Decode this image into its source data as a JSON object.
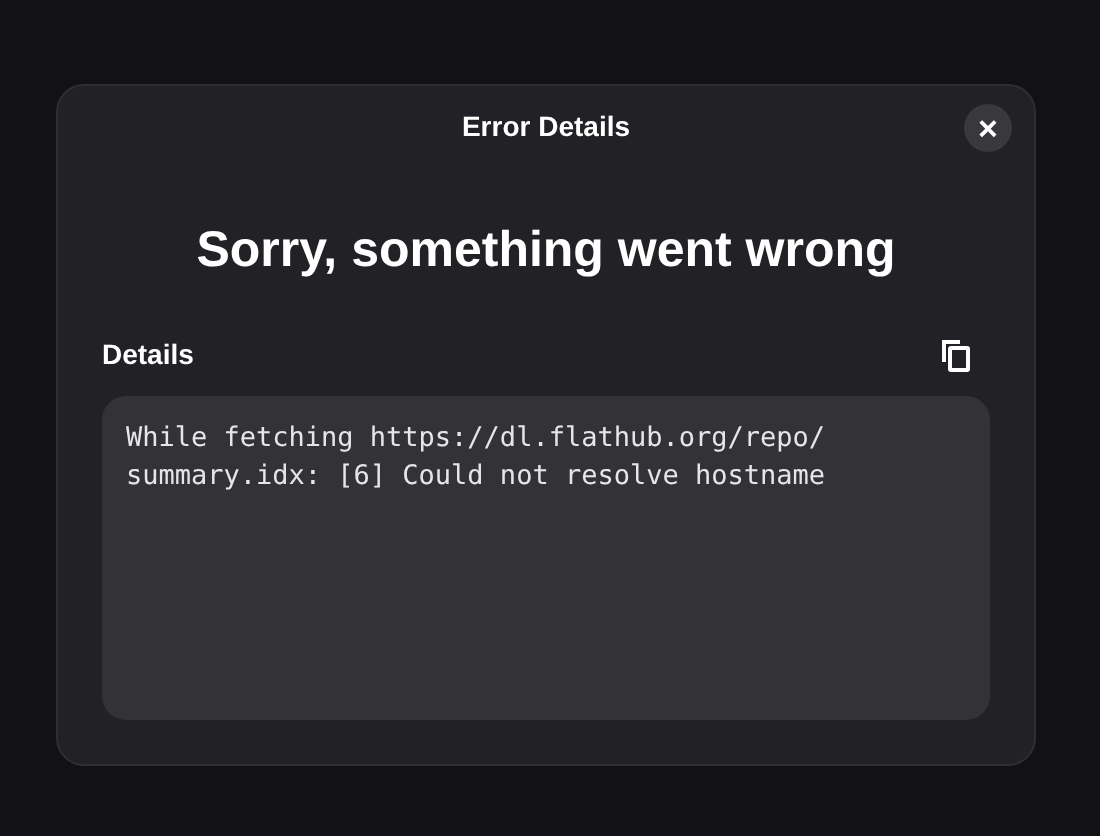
{
  "dialog": {
    "title": "Error Details",
    "close_label": "×",
    "heading": "Sorry, something went wrong",
    "details_label": "Details",
    "message_lines": [
      "While fetching https://dl.flathub.org/repo/",
      "summary.idx: [6] Could not resolve hostname"
    ]
  }
}
